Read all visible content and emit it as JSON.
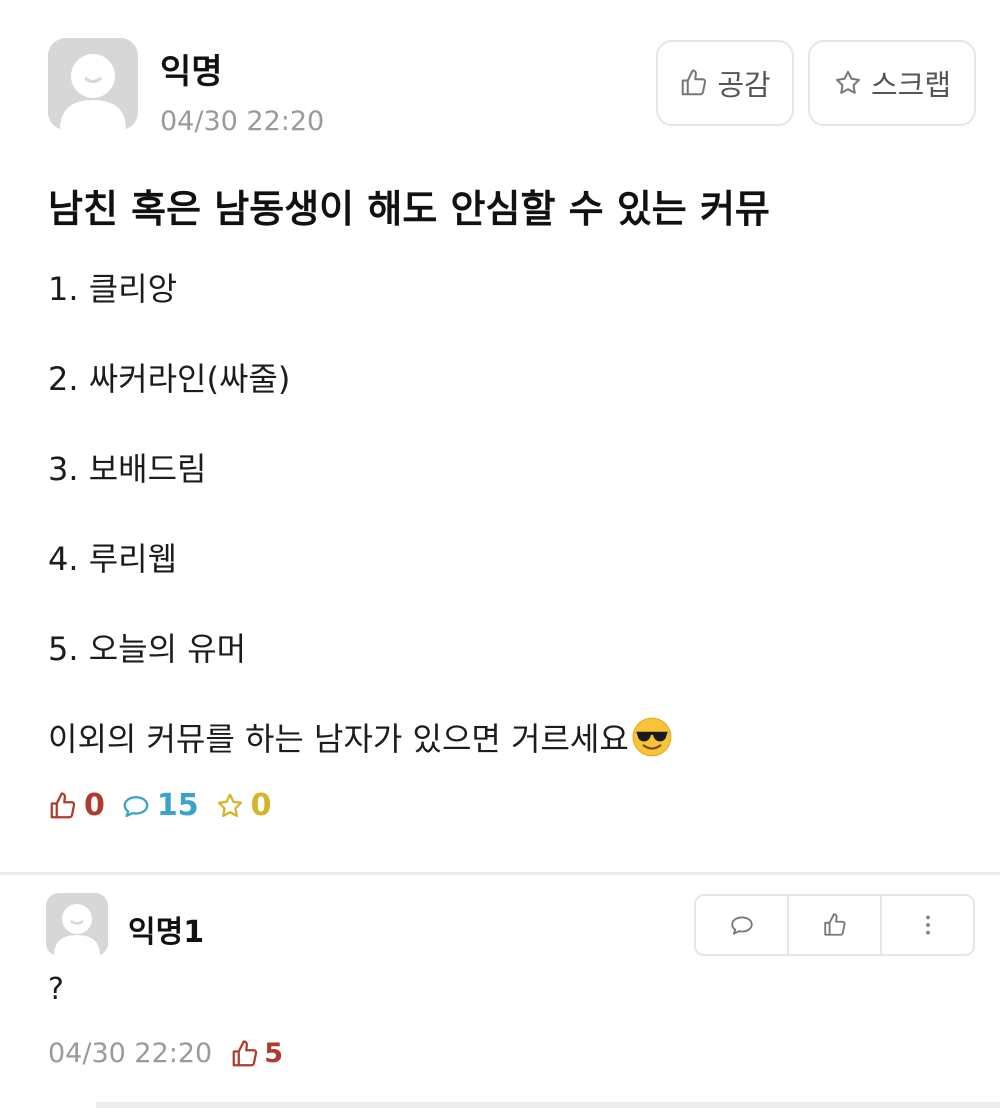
{
  "post": {
    "author": "익명",
    "date": "04/30 22:20",
    "buttons": {
      "like_label": "공감",
      "scrap_label": "스크랩"
    },
    "title": "남친 혹은 남동생이 해도 안심할 수 있는 커뮤",
    "lines": [
      "1. 클리앙",
      "2. 싸커라인(싸줄)",
      "3. 보배드림",
      "4. 루리웹",
      "5. 오늘의 유머",
      "이외의 커뮤를 하는 남자가 있으면 거르세요"
    ],
    "emoji": "sunglasses-emoji",
    "stats": {
      "likes": "0",
      "comments": "15",
      "scraps": "0"
    }
  },
  "comment": {
    "author": "익명1",
    "text": "?",
    "date": "04/30 22:20",
    "likes": "5"
  },
  "colors": {
    "like": "#b03a2e",
    "comment": "#3aa3c9",
    "scrap": "#d4b429",
    "meta_gray": "#9a9a9a"
  }
}
